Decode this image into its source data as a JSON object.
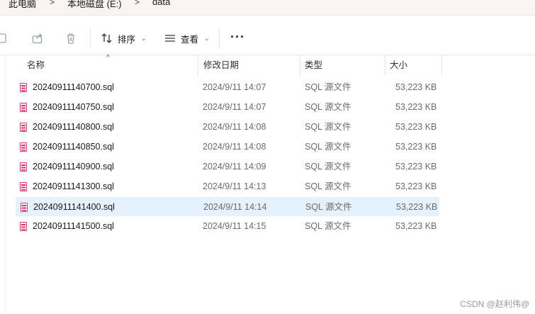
{
  "breadcrumb": {
    "items": [
      "此电脑",
      "本地磁盘 (E:)",
      "data"
    ],
    "separator": ">"
  },
  "toolbar": {
    "sort_label": "排序",
    "view_label": "查看",
    "more_label": "···"
  },
  "columns": {
    "name": "名称",
    "modified": "修改日期",
    "type": "类型",
    "size": "大小"
  },
  "files": [
    {
      "name": "20240911140700.sql",
      "modified": "2024/9/11 14:07",
      "type": "SQL 源文件",
      "size": "53,223 KB"
    },
    {
      "name": "20240911140750.sql",
      "modified": "2024/9/11 14:07",
      "type": "SQL 源文件",
      "size": "53,223 KB"
    },
    {
      "name": "20240911140800.sql",
      "modified": "2024/9/11 14:08",
      "type": "SQL 源文件",
      "size": "53,223 KB"
    },
    {
      "name": "20240911140850.sql",
      "modified": "2024/9/11 14:08",
      "type": "SQL 源文件",
      "size": "53,223 KB"
    },
    {
      "name": "20240911140900.sql",
      "modified": "2024/9/11 14:09",
      "type": "SQL 源文件",
      "size": "53,223 KB"
    },
    {
      "name": "20240911141300.sql",
      "modified": "2024/9/11 14:13",
      "type": "SQL 源文件",
      "size": "53,223 KB"
    },
    {
      "name": "20240911141400.sql",
      "modified": "2024/9/11 14:14",
      "type": "SQL 源文件",
      "size": "53,223 KB",
      "selected": true
    },
    {
      "name": "20240911141500.sql",
      "modified": "2024/9/11 14:15",
      "type": "SQL 源文件",
      "size": "53,223 KB"
    }
  ],
  "watermark": "CSDN @赵利伟@",
  "colors": {
    "selection": "#e5f1fb",
    "sql_icon": "#d6336c",
    "breadcrumb_bg": "#fbf4f4"
  }
}
